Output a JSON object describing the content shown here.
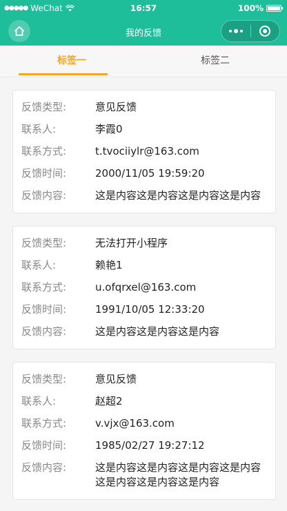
{
  "status_bar": {
    "carrier": "WeChat",
    "time": "16:57",
    "battery": "100%"
  },
  "nav": {
    "title": "我的反馈"
  },
  "tabs": [
    {
      "label": "标签一",
      "active": true
    },
    {
      "label": "标签二",
      "active": false
    }
  ],
  "labels": {
    "type": "反馈类型:",
    "contact": "联系人:",
    "method": "联系方式:",
    "time": "反馈时间:",
    "content": "反馈内容:"
  },
  "feedback": [
    {
      "type": "意见反馈",
      "contact": "李霞0",
      "method": "t.tvociiylr@163.com",
      "time": "2000/11/05 19:59:20",
      "content": "这是内容这是内容这是内容这是内容"
    },
    {
      "type": "无法打开小程序",
      "contact": "赖艳1",
      "method": "u.ofqrxel@163.com",
      "time": "1991/10/05 12:33:20",
      "content": "这是内容这是内容这是内容"
    },
    {
      "type": "意见反馈",
      "contact": "赵超2",
      "method": "v.vjx@163.com",
      "time": "1985/02/27 19:27:12",
      "content": "这是内容这是内容这是内容这是内容这是内容这是内容这是内容"
    }
  ],
  "colors": {
    "brand": "#1fbe9a",
    "tab_active": "#f5a623"
  }
}
